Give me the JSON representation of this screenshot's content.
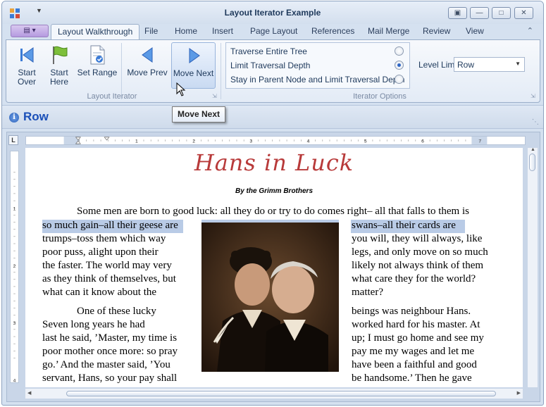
{
  "window": {
    "title": "Layout Iterator Example",
    "controls": [
      "restore",
      "minimize",
      "maximize",
      "close"
    ]
  },
  "tabs": [
    {
      "label": "Layout Walkthrough",
      "active": true
    },
    {
      "label": "File"
    },
    {
      "label": "Home"
    },
    {
      "label": "Insert"
    },
    {
      "label": "Page Layout"
    },
    {
      "label": "References"
    },
    {
      "label": "Mail Merge"
    },
    {
      "label": "Review"
    },
    {
      "label": "View"
    }
  ],
  "ribbon": {
    "iterator_group": {
      "label": "Layout Iterator",
      "buttons": {
        "start_over": "Start\nOver",
        "start_over_l1": "Start",
        "start_over_l2": "Over",
        "start_here_l1": "Start",
        "start_here_l2": "Here",
        "set_range": "Set Range",
        "move_prev": "Move Prev",
        "move_next": "Move Next"
      }
    },
    "options_group": {
      "label": "Iterator Options",
      "options": [
        {
          "label": "Traverse Entire Tree",
          "selected": false
        },
        {
          "label": "Limit Traversal Depth",
          "selected": true
        },
        {
          "label": "Stay in Parent Node and Limit Traversal Depth",
          "selected": false
        }
      ],
      "level_limit_label": "Level Limit",
      "level_limit_value": "Row"
    }
  },
  "tooltip": "Move Next",
  "status": {
    "text": "Row",
    "icon": "info-icon"
  },
  "document": {
    "title": "Hans in Luck",
    "byline": "By the Grimm Brothers",
    "highlight_color": "#b9cbe6",
    "lines_full": [
      "Some men are born to good luck: all they do or try to do comes right– all that falls to them is"
    ],
    "left_column": [
      "so much gain–all their geese are",
      "trumps–toss them which way",
      "poor puss, alight upon their",
      "the faster. The world may very",
      "as they think of themselves, but",
      "what can it know about the",
      "One of these lucky",
      "Seven long years he had",
      "last he said, ’Master, my time is",
      "poor mother once more: so pray",
      "go.’ And the master said, ’You",
      "servant, Hans, so your pay shall"
    ],
    "right_column": [
      "swans–all their cards are",
      "you will, they will always, like",
      "legs, and only move on so much",
      "likely not always think of them",
      "what care they for the world?",
      "matter?",
      "beings was neighbour Hans.",
      "worked hard for his master. At",
      "up; I must go home and see my",
      "pay me my wages and let me",
      "have been a faithful and good",
      "be handsome.’ Then he gave"
    ],
    "ruler_numbers": [
      "1",
      "2",
      "3",
      "4",
      "5",
      "6",
      "7"
    ],
    "vruler_numbers": [
      "1",
      "2",
      "3",
      "4"
    ]
  },
  "colors": {
    "accent": "#1a4fb8",
    "title_red": "#b83a3a",
    "ribbon_bg": "#e3ebf6"
  }
}
